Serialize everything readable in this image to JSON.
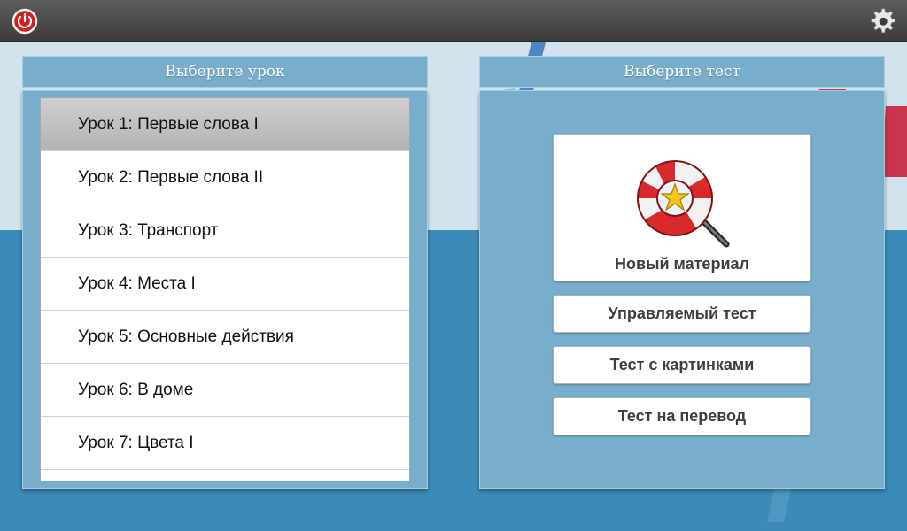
{
  "topbar": {
    "power_icon": "power-icon",
    "settings_icon": "gear-icon"
  },
  "lessons_panel": {
    "title": "Выберите урок",
    "items": [
      {
        "label": "Урок 1: Первые слова I",
        "selected": true
      },
      {
        "label": "Урок 2: Первые слова II"
      },
      {
        "label": "Урок 3: Транспорт"
      },
      {
        "label": "Урок 4: Места I"
      },
      {
        "label": "Урок 5: Основные действия"
      },
      {
        "label": "Урок 6: В доме"
      },
      {
        "label": "Урок 7: Цвета I"
      }
    ]
  },
  "tests_panel": {
    "title": "Выберите тест",
    "new_material": {
      "label": "Новый материал",
      "icon": "lifebuoy-magnifier-star-icon"
    },
    "guided_test": "Управляемый тест",
    "picture_test": "Тест с картинками",
    "translation_test": "Тест на перевод"
  },
  "colors": {
    "topbar": "#4a4a4a",
    "panel": "#78aecb",
    "background_top": "#d2e3ed",
    "background_bottom": "#3b8ab8",
    "power_red": "#d21f1f",
    "selected_item": "#bfbfbf"
  }
}
